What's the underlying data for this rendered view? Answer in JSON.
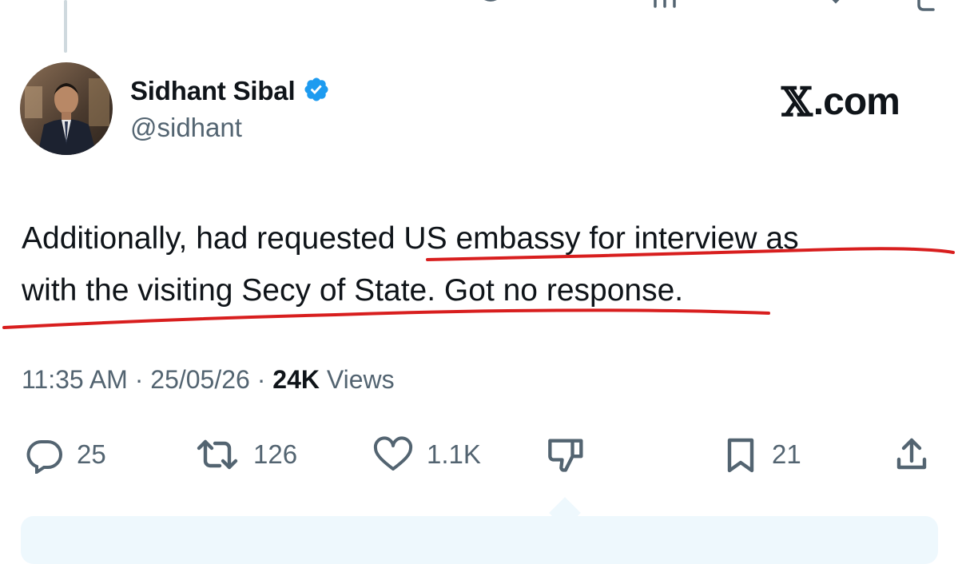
{
  "author": {
    "display_name": "Sidhant Sibal",
    "handle": "@sidhant",
    "verified": true
  },
  "brand": {
    "symbol": "𝕏",
    "suffix": ".com"
  },
  "tweet": {
    "line1": "Additionally, had requested US embassy for interview as",
    "line2": "with the visiting Secy of State. Got no response."
  },
  "meta": {
    "time": "11:35 AM",
    "date": "25/05/26",
    "views_count": "24K",
    "views_label": "Views",
    "sep": "·"
  },
  "actions": {
    "replies": "25",
    "reposts": "126",
    "likes": "1.1K",
    "bookmarks": "21"
  },
  "colors": {
    "text": "#0f1419",
    "muted": "#536471",
    "verified": "#1d9bf0",
    "annotation": "#d81e1e"
  },
  "icons": [
    "reply-icon",
    "repost-icon",
    "like-icon",
    "dislike-icon",
    "bookmark-icon",
    "share-icon",
    "verified-badge-icon"
  ]
}
